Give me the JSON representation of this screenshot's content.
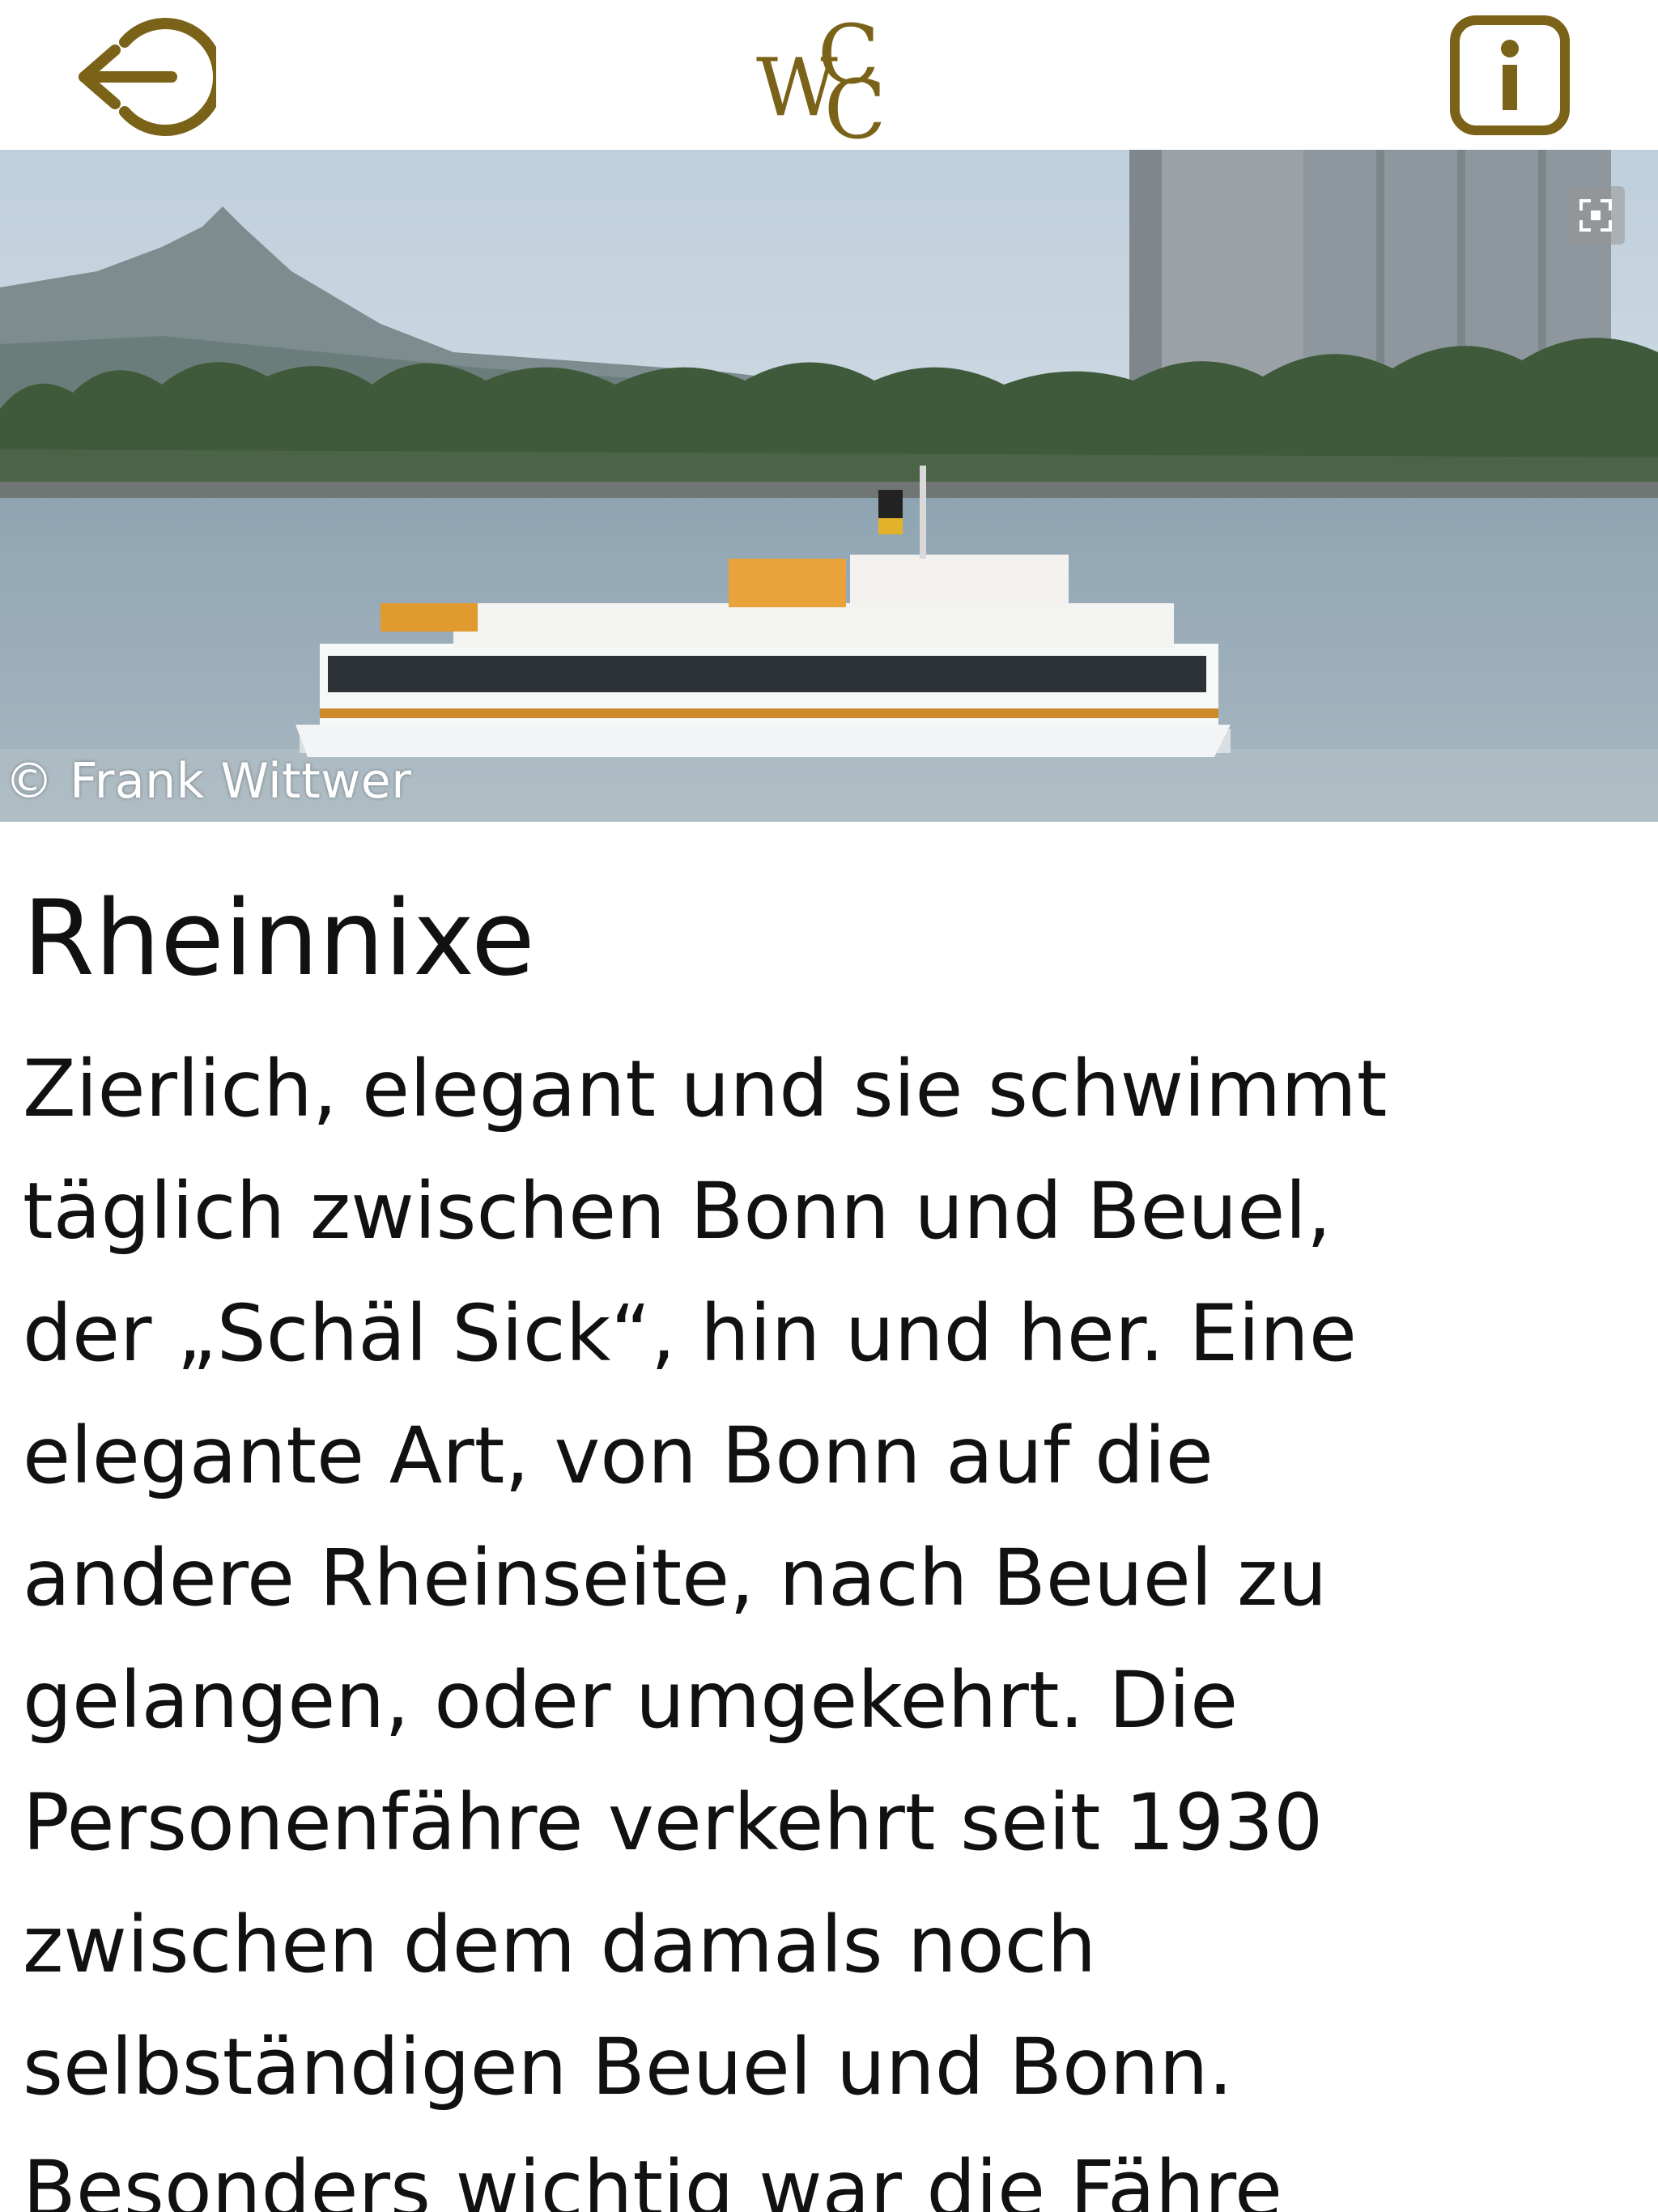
{
  "header": {
    "back_icon": "logout-arrow-icon",
    "logo_text": "WCC",
    "info_icon": "info-icon",
    "accent_color": "#7a6318"
  },
  "hero": {
    "image_subject": "passenger ferry on the Rhine",
    "credit": "© Frank Wittwer",
    "expand_icon": "expand-icon"
  },
  "article": {
    "title": "Rheinnixe",
    "lines": [
      "Zierlich, elegant und sie schwimmt",
      "täglich zwischen Bonn und Beuel,",
      "der „Schäl Sick“, hin und her. Eine",
      "elegante Art, von Bonn auf die",
      "andere Rheinseite, nach Beuel zu",
      "gelangen, oder umgekehrt. Die",
      "Personenfähre verkehrt seit 1930",
      "zwischen dem damals noch",
      "selbständigen Beuel und Bonn.",
      "Besonders wichtig war die Fähre"
    ]
  }
}
